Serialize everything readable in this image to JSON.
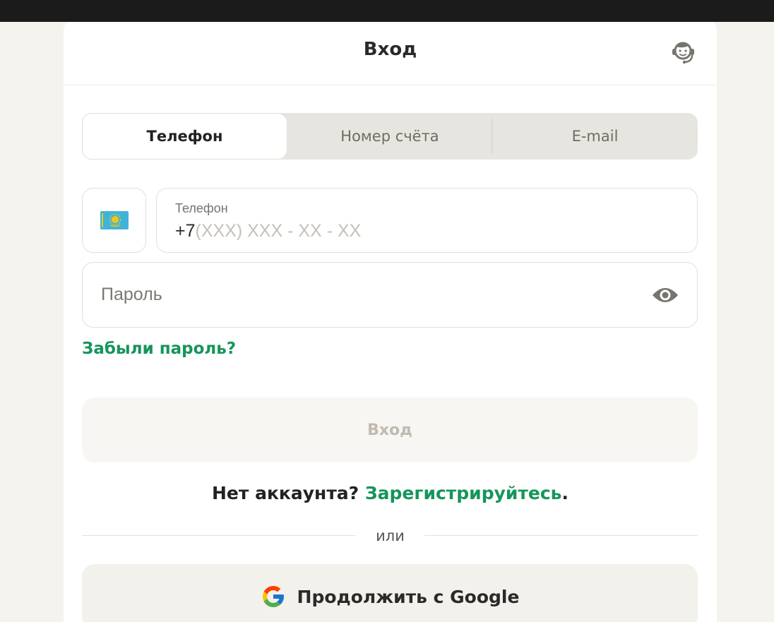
{
  "header": {
    "title": "Вход",
    "support_icon": "headset-support-icon"
  },
  "tabs": [
    {
      "label": "Телефон",
      "active": true
    },
    {
      "label": "Номер счёта",
      "active": false
    },
    {
      "label": "E-mail",
      "active": false
    }
  ],
  "phone": {
    "country_flag": "kazakhstan-flag-icon",
    "label": "Телефон",
    "prefix": "+7",
    "mask": "(XXX) XXX - XX - XX"
  },
  "password": {
    "placeholder": "Пароль",
    "toggle_icon": "eye-icon"
  },
  "forgot_password": "Забыли пароль?",
  "login_button": "Вход",
  "signup": {
    "text": "Нет аккаунта?",
    "link": "Зарегистрируйтесь",
    "suffix": "."
  },
  "separator": "или",
  "google_button": {
    "label": "Продолжить с Google",
    "icon": "google-logo-icon"
  },
  "colors": {
    "accent_green": "#15955a",
    "page_bg": "#f4f3ee",
    "disabled_text": "#c0bab0"
  }
}
